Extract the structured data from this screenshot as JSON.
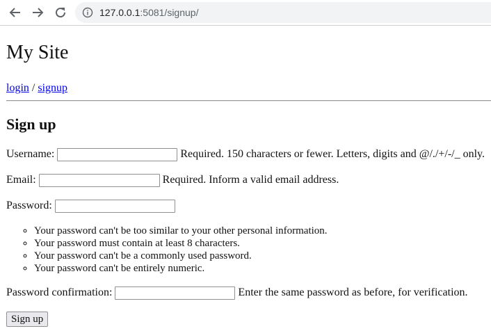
{
  "browser": {
    "url_host": "127.0.0.1",
    "url_rest": ":5081/signup/"
  },
  "site": {
    "title": "My Site",
    "nav": {
      "login": "login",
      "separator": " / ",
      "signup": "signup"
    }
  },
  "form": {
    "title": "Sign up",
    "username": {
      "label": "Username:",
      "value": "",
      "help": "Required. 150 characters or fewer. Letters, digits and @/./+/-/_ only."
    },
    "email": {
      "label": "Email:",
      "value": "",
      "help": "Required. Inform a valid email address."
    },
    "password": {
      "label": "Password:",
      "value": "",
      "rules": [
        "Your password can't be too similar to your other personal information.",
        "Your password must contain at least 8 characters.",
        "Your password can't be a commonly used password.",
        "Your password can't be entirely numeric."
      ]
    },
    "password_confirmation": {
      "label": "Password confirmation:",
      "value": "",
      "help": "Enter the same password as before, for verification."
    },
    "submit_label": "Sign up"
  }
}
